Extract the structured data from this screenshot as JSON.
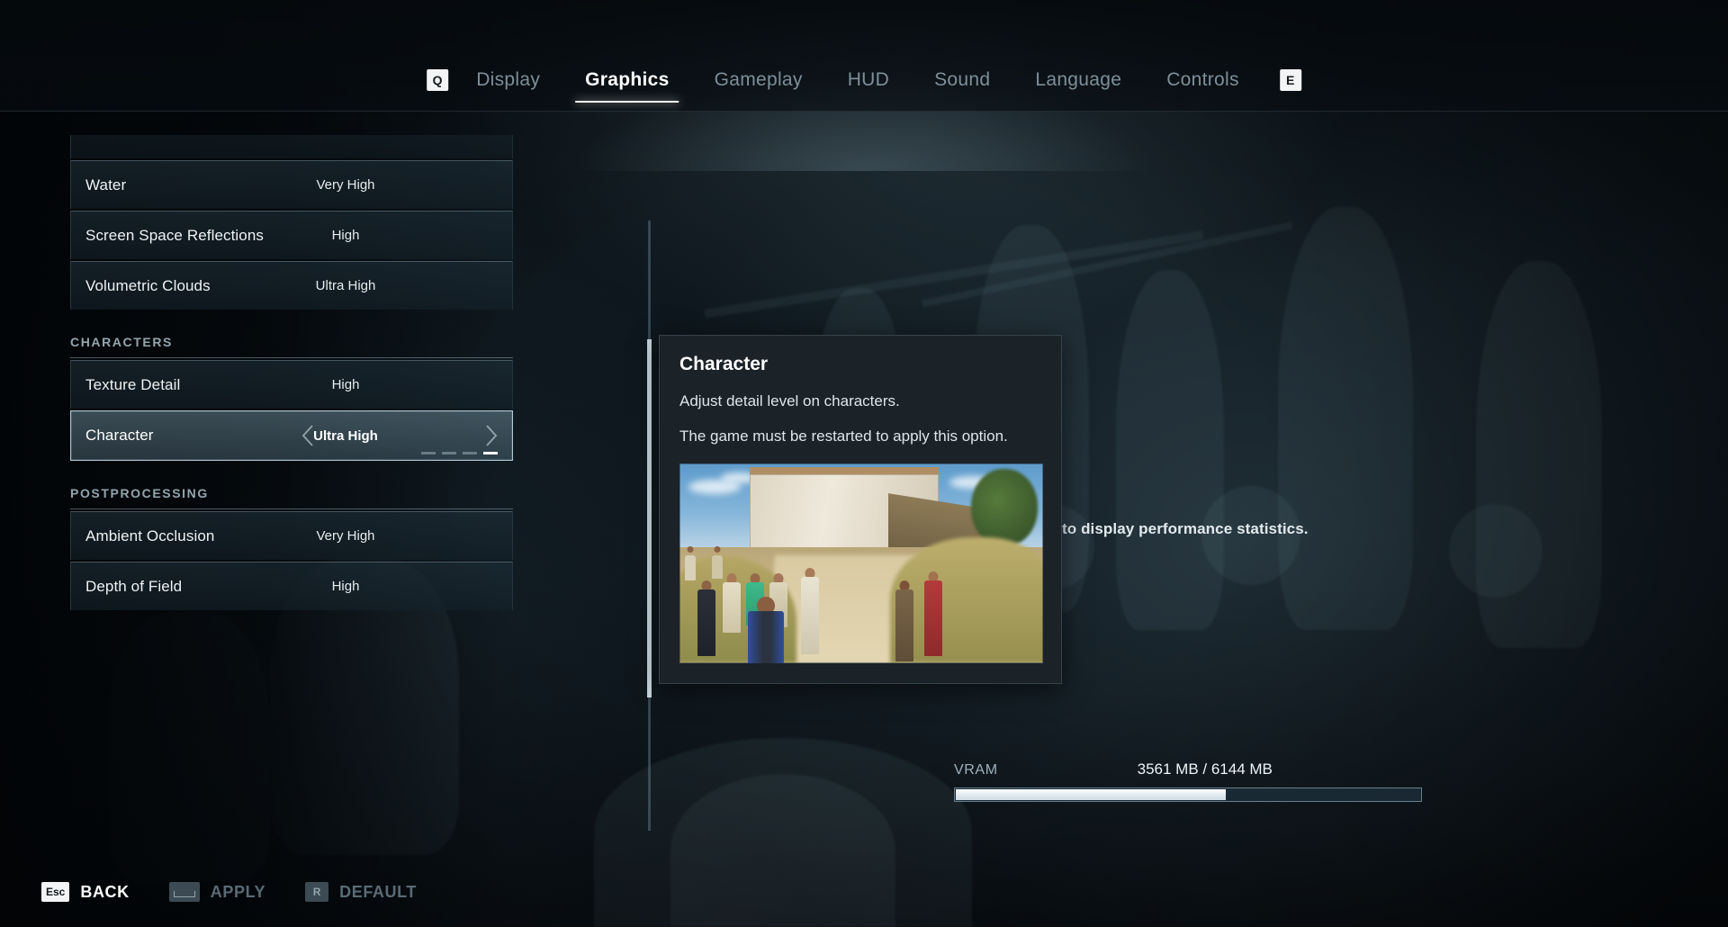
{
  "nav": {
    "left_key": "Q",
    "right_key": "E",
    "tabs": [
      {
        "label": "Display",
        "active": false
      },
      {
        "label": "Graphics",
        "active": true
      },
      {
        "label": "Gameplay",
        "active": false
      },
      {
        "label": "HUD",
        "active": false
      },
      {
        "label": "Sound",
        "active": false
      },
      {
        "label": "Language",
        "active": false
      },
      {
        "label": "Controls",
        "active": false
      }
    ]
  },
  "settings": {
    "groups": [
      {
        "header": null,
        "rows": [
          {
            "label": "Water",
            "value": "Very High",
            "selected": false
          },
          {
            "label": "Screen Space Reflections",
            "value": "High",
            "selected": false
          },
          {
            "label": "Volumetric Clouds",
            "value": "Ultra High",
            "selected": false
          }
        ]
      },
      {
        "header": "CHARACTERS",
        "rows": [
          {
            "label": "Texture Detail",
            "value": "High",
            "selected": false
          },
          {
            "label": "Character",
            "value": "Ultra High",
            "selected": true,
            "steps": 4,
            "step_active": 4
          }
        ]
      },
      {
        "header": "POSTPROCESSING",
        "rows": [
          {
            "label": "Ambient Occlusion",
            "value": "Very High",
            "selected": false
          },
          {
            "label": "Depth of Field",
            "value": "High",
            "selected": false
          }
        ]
      }
    ]
  },
  "tooltip": {
    "title": "Character",
    "description": "Adjust detail level on characters.",
    "restart_note": "The game must be restarted to apply this option.",
    "preview_alt": "character-quality-preview"
  },
  "background_text": {
    "perf_stats": "to display performance statistics."
  },
  "vram": {
    "label": "VRAM",
    "value": "3561 MB / 6144 MB",
    "used_mb": 3561,
    "total_mb": 6144,
    "percent": 58
  },
  "actions": [
    {
      "key": "Esc",
      "label": "BACK",
      "enabled": true,
      "keytype": "light"
    },
    {
      "key": "",
      "label": "APPLY",
      "enabled": false,
      "keytype": "space"
    },
    {
      "key": "R",
      "label": "DEFAULT",
      "enabled": false,
      "keytype": "dim"
    }
  ],
  "colors": {
    "accent": "#ffffff",
    "panel": "#1b2228",
    "row": "#1e2e38",
    "selected_row": "#68848f",
    "muted_text": "#7d8f99"
  }
}
